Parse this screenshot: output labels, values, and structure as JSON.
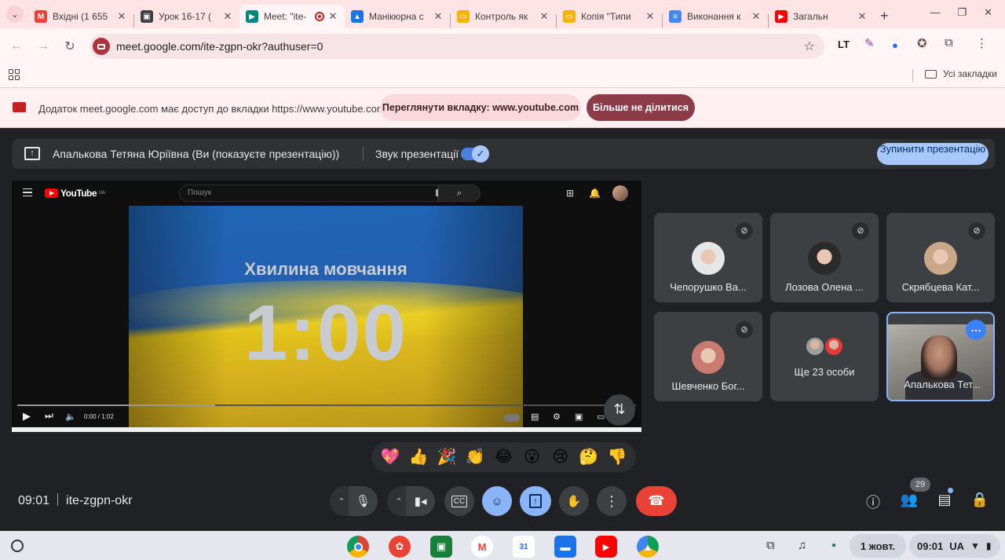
{
  "browser": {
    "tabs": [
      {
        "title": "Вхідні (1 655",
        "fav_color": "#ea4335",
        "fav_glyph": "M"
      },
      {
        "title": "Урок 16-17 (",
        "fav_color": "#3c4043",
        "fav_glyph": "▣"
      },
      {
        "title": "Meet: \"ite-",
        "fav_color": "#00897b",
        "fav_glyph": "▶",
        "active": true
      },
      {
        "title": "Манікюрна с",
        "fav_color": "#1a73e8",
        "fav_glyph": "▲"
      },
      {
        "title": "Контроль як",
        "fav_color": "#f4b400",
        "fav_glyph": "▭"
      },
      {
        "title": "Копія \"Типи",
        "fav_color": "#f4b400",
        "fav_glyph": "▭"
      },
      {
        "title": "Виконання к",
        "fav_color": "#4285f4",
        "fav_glyph": "≡"
      },
      {
        "title": "Загальн",
        "fav_color": "#ff0000",
        "fav_glyph": "▶"
      }
    ],
    "url": "meet.google.com/ite-zgpn-okr?authuser=0",
    "all_bookmarks": "Усі закладки"
  },
  "infobar": {
    "message": "Додаток meet.google.com має доступ до вкладки https://www.youtube.com",
    "view_tab": "Переглянути вкладку: www.youtube.com",
    "stop_sharing": "Більше не ділитися"
  },
  "presenting": {
    "label": "Апалькова Тетяна Юріївна (Ви (показуєте презентацію))",
    "audio_label": "Звук презентації",
    "stop_button": "Зупинити презентацію"
  },
  "youtube": {
    "logo_text": "YouTube",
    "region": "UA",
    "search_placeholder": "Пошук",
    "video_title": "Хвилина мовчання",
    "video_timer": "1:00",
    "time": "0:00 / 1:02",
    "progress": 0.0,
    "buffered": 0.32
  },
  "participants": [
    {
      "name": "Чепорушко Ва...",
      "muted": true,
      "avatar": "#e6e6e6"
    },
    {
      "name": "Лозова Олена ...",
      "muted": true,
      "avatar": "#2a2a2a"
    },
    {
      "name": "Скрябцева Кат...",
      "muted": true,
      "avatar": "#c9a889"
    },
    {
      "name": "Шевченко Бог...",
      "muted": true,
      "avatar": "#c97b6f"
    },
    {
      "name": "Ще 23 особи",
      "muted": false,
      "avatar": ""
    },
    {
      "name": "Апалькова Тет...",
      "muted": false,
      "avatar": "self"
    }
  ],
  "reactions": [
    "💖",
    "👍",
    "🎉",
    "👏",
    "😂",
    "😮",
    "😢",
    "🤔",
    "👎"
  ],
  "meet": {
    "clock": "09:01",
    "meeting_code": "ite-zgpn-okr",
    "people_count": "29"
  },
  "shelf": {
    "date": "1 жовт.",
    "time": "09:01",
    "locale": "UA"
  },
  "colors": {
    "tab_strip": "#ffe4e6",
    "meet_bg": "#202124",
    "accent_blue": "#8ab4f8",
    "end_call": "#ea4335"
  }
}
